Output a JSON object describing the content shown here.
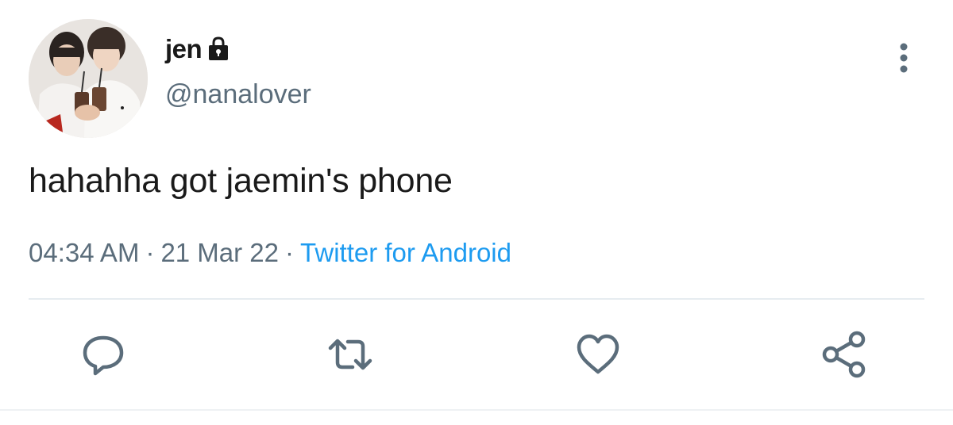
{
  "user": {
    "display_name": "jen",
    "handle": "@nanalover",
    "protected_icon": "lock-icon",
    "avatar": "profile-photo"
  },
  "tweet": {
    "text": "hahahha got jaemin's phone"
  },
  "meta": {
    "time": "04:34 AM",
    "separator": "·",
    "date": "21 Mar 22",
    "source": "Twitter for Android"
  },
  "actions": {
    "reply_icon": "comment-icon",
    "retweet_icon": "retweet-icon",
    "like_icon": "heart-icon",
    "share_icon": "share-icon",
    "more_icon": "more-vertical-icon"
  },
  "colors": {
    "text": "#1a1a1a",
    "secondary": "#5b6d7b",
    "link": "#1d9bf0",
    "icon": "#5b6d7b",
    "divider": "#e6ecf0"
  }
}
